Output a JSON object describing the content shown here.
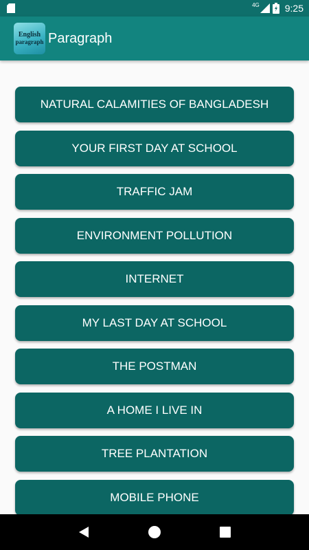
{
  "status_bar": {
    "network_type": "4G",
    "time": "9:25",
    "icons": [
      "sd-card-icon",
      "signal-icon",
      "battery-charging-icon"
    ]
  },
  "app_bar": {
    "logo": {
      "line1": "English",
      "line2": "paragraph"
    },
    "title": "Paragraph"
  },
  "topics": [
    {
      "label": "NATURAL CALAMITIES OF BANGLADESH"
    },
    {
      "label": "YOUR FIRST DAY AT SCHOOL"
    },
    {
      "label": "TRAFFIC JAM"
    },
    {
      "label": "ENVIRONMENT POLLUTION"
    },
    {
      "label": "INTERNET"
    },
    {
      "label": "MY LAST DAY AT SCHOOL"
    },
    {
      "label": "THE POSTMAN"
    },
    {
      "label": "A HOME I LIVE IN"
    },
    {
      "label": "TREE PLANTATION"
    },
    {
      "label": "MOBILE PHONE"
    }
  ],
  "navigation": {
    "icons": [
      "back-icon",
      "home-icon",
      "recents-icon"
    ]
  },
  "colors": {
    "status_bar": "#0e6f6b",
    "app_bar": "#12847f",
    "button": "#0c6663",
    "background": "#fafafa",
    "nav_bar": "#000000"
  }
}
